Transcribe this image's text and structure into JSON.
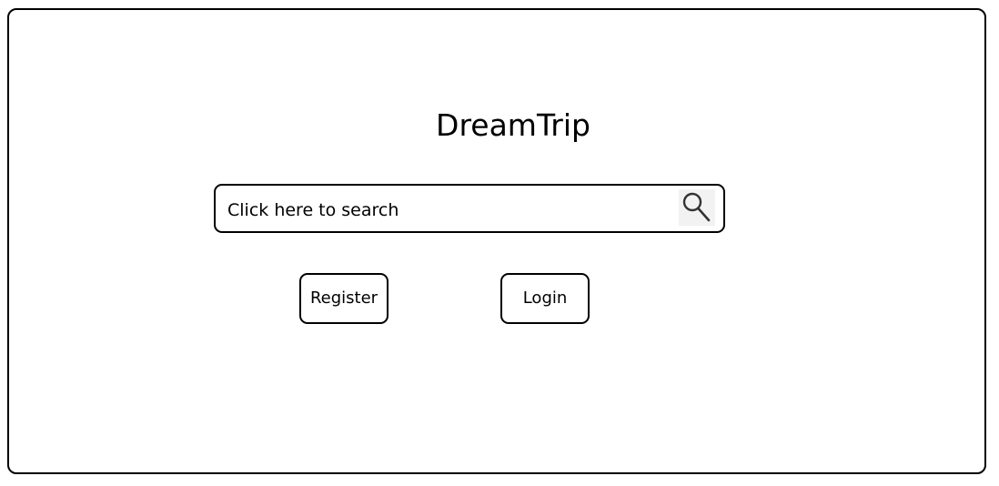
{
  "app": {
    "title": "DreamTrip"
  },
  "search": {
    "placeholder": "Click here to search",
    "icon": "search-icon"
  },
  "actions": {
    "register_label": "Register",
    "login_label": "Login"
  }
}
